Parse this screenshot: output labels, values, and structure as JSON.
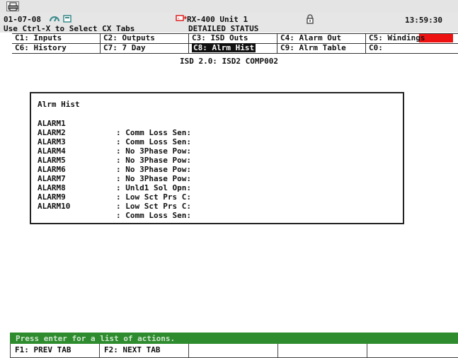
{
  "header": {
    "date": "01-07-08",
    "hint": "Use Ctrl-X to Select CX Tabs",
    "unit_title": "RX-400 Unit 1",
    "status_title": "DETAILED STATUS",
    "clock": "13:59:30"
  },
  "tabs": [
    {
      "label": "C1: Inputs"
    },
    {
      "label": "C2: Outputs"
    },
    {
      "label": "C3: ISD Outs"
    },
    {
      "label": "C4: Alarm Out"
    },
    {
      "label": "C5: Windings"
    },
    {
      "label": "C6: History"
    },
    {
      "label": "C7: 7 Day"
    },
    {
      "label": "C8: Alrm Hist",
      "active": true
    },
    {
      "label": "C9: Alrm Table"
    },
    {
      "label": "C0:"
    }
  ],
  "screen_title": "ISD 2.0: ISD2 COMP002",
  "panel": {
    "title": "Alrm Hist",
    "rows": [
      {
        "name": "ALARM1",
        "value": ": Comm Loss Sen:"
      },
      {
        "name": "ALARM2",
        "value": ": Comm Loss Sen:"
      },
      {
        "name": "ALARM3",
        "value": ": No 3Phase Pow:"
      },
      {
        "name": "ALARM4",
        "value": ": No 3Phase Pow:"
      },
      {
        "name": "ALARM5",
        "value": ": No 3Phase Pow:"
      },
      {
        "name": "ALARM6",
        "value": ": No 3Phase Pow:"
      },
      {
        "name": "ALARM7",
        "value": ": Unld1 Sol Opn:"
      },
      {
        "name": "ALARM8",
        "value": ": Low Sct Prs C:"
      },
      {
        "name": "ALARM9",
        "value": ": Low Sct Prs C:"
      },
      {
        "name": "ALARM10",
        "value": ": Comm Loss Sen:"
      }
    ]
  },
  "statusbar": {
    "message": "Press enter for a list of actions."
  },
  "fkeys": [
    {
      "label": "F1: PREV TAB"
    },
    {
      "label": "F2: NEXT TAB"
    },
    {
      "label": ""
    },
    {
      "label": ""
    },
    {
      "label": ""
    }
  ],
  "icons": {
    "print": "printer-icon",
    "gauge": "gauge-icon",
    "battery": "battery-icon",
    "alert": "alert-icon",
    "lock": "lock-icon"
  },
  "colors": {
    "alarm_indicator": "#ee1111",
    "statusbar": "#2e8b2e",
    "icon_teal": "#3a8a8a",
    "alert_red": "#dd2222"
  }
}
